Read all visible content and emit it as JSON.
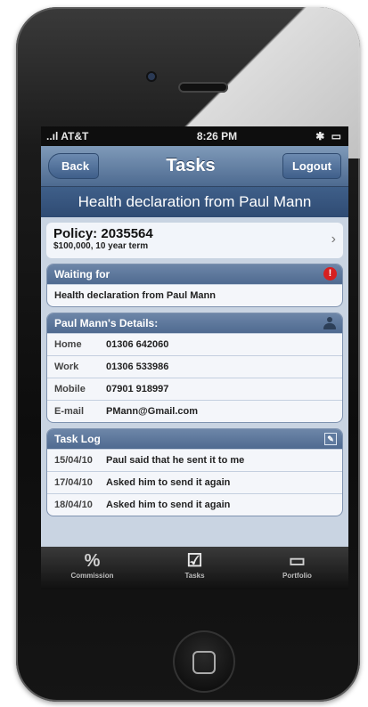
{
  "status": {
    "carrier": "..ıl AT&T",
    "time": "8:26 PM",
    "indicators": "✱ ▭"
  },
  "nav": {
    "back_label": "Back",
    "title": "Tasks",
    "logout_label": "Logout"
  },
  "subheader": "Health declaration from Paul Mann",
  "policy": {
    "number": "Policy: 2035564",
    "term": "$100,000, 10 year term"
  },
  "waiting": {
    "heading": "Waiting for",
    "text": "Health declaration from Paul Mann"
  },
  "details": {
    "heading": "Paul Mann's Details:",
    "rows": [
      {
        "label": "Home",
        "value": "01306 642060"
      },
      {
        "label": "Work",
        "value": "01306 533986"
      },
      {
        "label": "Mobile",
        "value": "07901 918997"
      },
      {
        "label": "E-mail",
        "value": "PMann@Gmail.com"
      }
    ]
  },
  "tasklog": {
    "heading": "Task Log",
    "rows": [
      {
        "date": "15/04/10",
        "text": "Paul said that he sent it to me"
      },
      {
        "date": "17/04/10",
        "text": "Asked him to send it again"
      },
      {
        "date": "18/04/10",
        "text": "Asked him to send it again"
      }
    ]
  },
  "tabs": [
    {
      "label": "Commission",
      "icon": "%"
    },
    {
      "label": "Tasks",
      "icon": "☑"
    },
    {
      "label": "Portfolio",
      "icon": "▭"
    }
  ],
  "icons": {
    "alert": "!",
    "edit": "✎",
    "chevron": "›"
  }
}
